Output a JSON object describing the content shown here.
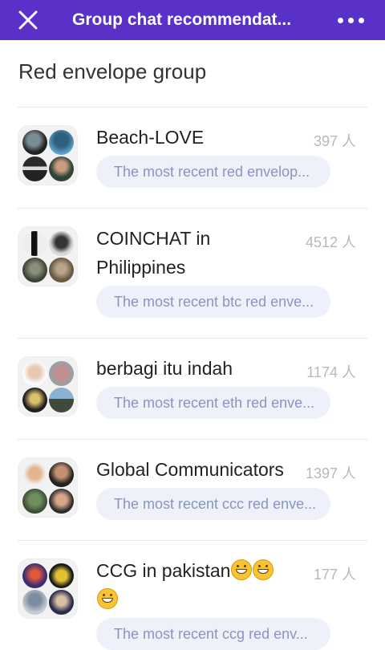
{
  "header": {
    "title": "Group chat recommendat...",
    "close_icon": "close-icon",
    "more_icon": "more-dots-icon",
    "background_color": "#5a31c8"
  },
  "section": {
    "title": "Red envelope group"
  },
  "groups": [
    {
      "name": "Beach-LOVE",
      "count": "397 人",
      "preview": "The most recent red envelop..."
    },
    {
      "name": "COINCHAT in Philippines",
      "count": "4512 人",
      "preview": "The most recent btc red enve..."
    },
    {
      "name": "berbagi itu indah",
      "count": "1174 人",
      "preview": "The most recent eth red enve..."
    },
    {
      "name": "Global Communicators",
      "count": "1397 人",
      "preview": "The most recent ccc red enve..."
    },
    {
      "name": "CCG in pakistan",
      "name_emoji": "grinning-face-emoji",
      "count": "177 人",
      "preview": "The most recent ccg red env..."
    }
  ]
}
